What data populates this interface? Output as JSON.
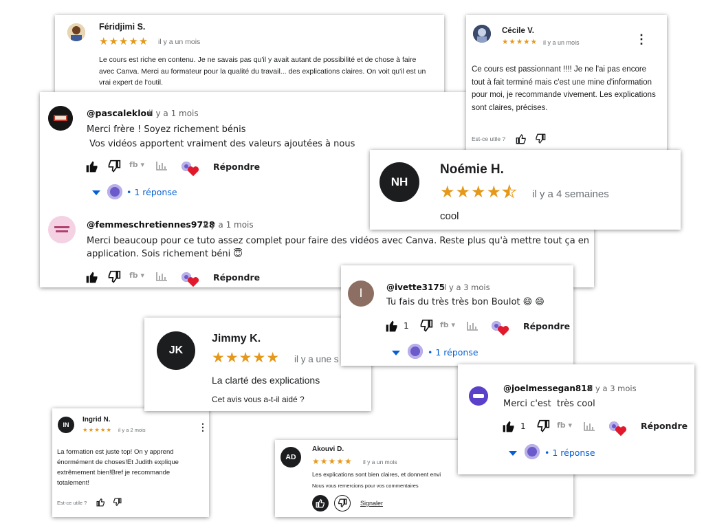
{
  "reviews": {
    "feridjimi": {
      "name": "Féridjimi S.",
      "stars": "★★★★★",
      "time": "il y a un mois",
      "text": "Le cours est riche en contenu. Je ne savais pas qu'il y avait autant de possibilité et de chose à faire avec Canva. Merci au formateur pour la qualité du travail... des explications claires. On voit qu'il est un vrai expert de l'outil."
    },
    "cecile": {
      "name": "Cécile V.",
      "stars": "★★★★★",
      "time": "il y a un mois",
      "text": "Ce cours est passionnant !!!! Je ne l'ai pas encore tout à fait terminé mais c'est une mine d'information pour moi, je recommande vivement. Les explications sont claires, précises.",
      "helpful": "Est-ce utile ?"
    },
    "noemie": {
      "initials": "NH",
      "name": "Noémie H.",
      "stars": "★★★★",
      "half_star": "★",
      "rating": 4.5,
      "time": "il y a 4 semaines",
      "text": "cool"
    },
    "jimmy": {
      "initials": "JK",
      "name": "Jimmy K.",
      "stars": "★★★★★",
      "time": "il y a une s",
      "text": "La clarté des explications",
      "helpful": "Cet avis vous a-t-il aidé ?"
    },
    "ingrid": {
      "initials": "IN",
      "name": "Ingrid N.",
      "stars": "★★★★★",
      "time": "il y a 2 mois",
      "text": "La formation est juste top! On y apprend énormément de choses!Et Judith explique extrêmement bien!Bref je recommande totalement!",
      "helpful": "Est-ce utile ?"
    },
    "akouvi": {
      "initials": "AD",
      "name": "Akouvi D.",
      "stars": "★★★★★",
      "time": "il y a un mois",
      "text": "Les explications sont bien claires, et donnent envi",
      "thanks": "Nous vous remercions pour vos commentaires",
      "report": "Signaler"
    }
  },
  "comments": {
    "pascal": {
      "handle": "@pascaleklou",
      "time": "il y a 1 mois",
      "line1": "Merci frère ! Soyez richement bénis",
      "line2": " Vos vidéos apportent vraiment des valeurs ajoutées à nous",
      "reply": "Répondre",
      "replies": "1 réponse"
    },
    "femmes": {
      "handle": "@femmeschretiennes9728",
      "time": "il y a 1 mois",
      "line1": "Merci beaucoup pour ce tuto assez complet pour faire des vidéos avec Canva. Reste plus qu'à mettre tout ça en",
      "line2": "application. Sois richement béni 😇",
      "reply": "Répondre"
    },
    "ivette": {
      "initial": "I",
      "handle": "@ivette3175",
      "time": "il y a 3 mois",
      "text": "Tu fais du très très bon Boulot 😄 😄",
      "likes": "1",
      "reply": "Répondre",
      "replies": "1 réponse"
    },
    "joel": {
      "handle": "@joelmessegan818",
      "time": "il y a 3 mois",
      "text": "Merci c'est  très cool",
      "likes": "1",
      "reply": "Répondre",
      "replies": "1 réponse"
    }
  },
  "icons": [
    "thumb-up-icon",
    "thumb-down-icon",
    "fb-icon",
    "chevron-down-icon",
    "stats-icon",
    "heart-icon",
    "more-vert-icon"
  ],
  "colors": {
    "star": "#e59819",
    "link_blue": "#065fd4",
    "avatar_dark": "#1c1d1f",
    "heart": "#e0192c"
  }
}
